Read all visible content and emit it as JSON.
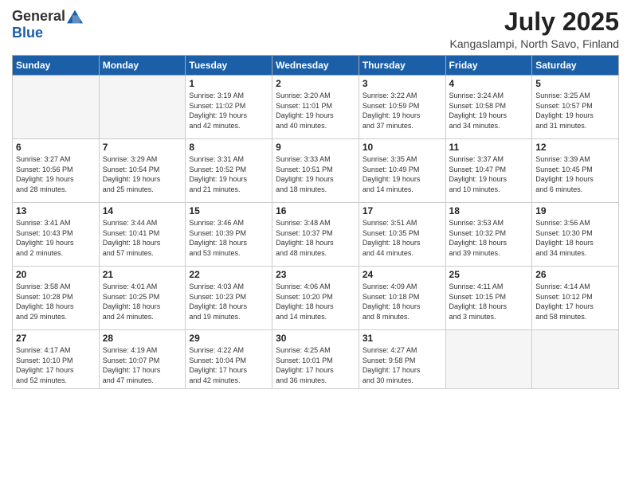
{
  "logo": {
    "general": "General",
    "blue": "Blue"
  },
  "title": "July 2025",
  "location": "Kangaslampi, North Savo, Finland",
  "days_header": [
    "Sunday",
    "Monday",
    "Tuesday",
    "Wednesday",
    "Thursday",
    "Friday",
    "Saturday"
  ],
  "weeks": [
    [
      {
        "day": "",
        "info": ""
      },
      {
        "day": "",
        "info": ""
      },
      {
        "day": "1",
        "info": "Sunrise: 3:19 AM\nSunset: 11:02 PM\nDaylight: 19 hours\nand 42 minutes."
      },
      {
        "day": "2",
        "info": "Sunrise: 3:20 AM\nSunset: 11:01 PM\nDaylight: 19 hours\nand 40 minutes."
      },
      {
        "day": "3",
        "info": "Sunrise: 3:22 AM\nSunset: 10:59 PM\nDaylight: 19 hours\nand 37 minutes."
      },
      {
        "day": "4",
        "info": "Sunrise: 3:24 AM\nSunset: 10:58 PM\nDaylight: 19 hours\nand 34 minutes."
      },
      {
        "day": "5",
        "info": "Sunrise: 3:25 AM\nSunset: 10:57 PM\nDaylight: 19 hours\nand 31 minutes."
      }
    ],
    [
      {
        "day": "6",
        "info": "Sunrise: 3:27 AM\nSunset: 10:56 PM\nDaylight: 19 hours\nand 28 minutes."
      },
      {
        "day": "7",
        "info": "Sunrise: 3:29 AM\nSunset: 10:54 PM\nDaylight: 19 hours\nand 25 minutes."
      },
      {
        "day": "8",
        "info": "Sunrise: 3:31 AM\nSunset: 10:52 PM\nDaylight: 19 hours\nand 21 minutes."
      },
      {
        "day": "9",
        "info": "Sunrise: 3:33 AM\nSunset: 10:51 PM\nDaylight: 19 hours\nand 18 minutes."
      },
      {
        "day": "10",
        "info": "Sunrise: 3:35 AM\nSunset: 10:49 PM\nDaylight: 19 hours\nand 14 minutes."
      },
      {
        "day": "11",
        "info": "Sunrise: 3:37 AM\nSunset: 10:47 PM\nDaylight: 19 hours\nand 10 minutes."
      },
      {
        "day": "12",
        "info": "Sunrise: 3:39 AM\nSunset: 10:45 PM\nDaylight: 19 hours\nand 6 minutes."
      }
    ],
    [
      {
        "day": "13",
        "info": "Sunrise: 3:41 AM\nSunset: 10:43 PM\nDaylight: 19 hours\nand 2 minutes."
      },
      {
        "day": "14",
        "info": "Sunrise: 3:44 AM\nSunset: 10:41 PM\nDaylight: 18 hours\nand 57 minutes."
      },
      {
        "day": "15",
        "info": "Sunrise: 3:46 AM\nSunset: 10:39 PM\nDaylight: 18 hours\nand 53 minutes."
      },
      {
        "day": "16",
        "info": "Sunrise: 3:48 AM\nSunset: 10:37 PM\nDaylight: 18 hours\nand 48 minutes."
      },
      {
        "day": "17",
        "info": "Sunrise: 3:51 AM\nSunset: 10:35 PM\nDaylight: 18 hours\nand 44 minutes."
      },
      {
        "day": "18",
        "info": "Sunrise: 3:53 AM\nSunset: 10:32 PM\nDaylight: 18 hours\nand 39 minutes."
      },
      {
        "day": "19",
        "info": "Sunrise: 3:56 AM\nSunset: 10:30 PM\nDaylight: 18 hours\nand 34 minutes."
      }
    ],
    [
      {
        "day": "20",
        "info": "Sunrise: 3:58 AM\nSunset: 10:28 PM\nDaylight: 18 hours\nand 29 minutes."
      },
      {
        "day": "21",
        "info": "Sunrise: 4:01 AM\nSunset: 10:25 PM\nDaylight: 18 hours\nand 24 minutes."
      },
      {
        "day": "22",
        "info": "Sunrise: 4:03 AM\nSunset: 10:23 PM\nDaylight: 18 hours\nand 19 minutes."
      },
      {
        "day": "23",
        "info": "Sunrise: 4:06 AM\nSunset: 10:20 PM\nDaylight: 18 hours\nand 14 minutes."
      },
      {
        "day": "24",
        "info": "Sunrise: 4:09 AM\nSunset: 10:18 PM\nDaylight: 18 hours\nand 8 minutes."
      },
      {
        "day": "25",
        "info": "Sunrise: 4:11 AM\nSunset: 10:15 PM\nDaylight: 18 hours\nand 3 minutes."
      },
      {
        "day": "26",
        "info": "Sunrise: 4:14 AM\nSunset: 10:12 PM\nDaylight: 17 hours\nand 58 minutes."
      }
    ],
    [
      {
        "day": "27",
        "info": "Sunrise: 4:17 AM\nSunset: 10:10 PM\nDaylight: 17 hours\nand 52 minutes."
      },
      {
        "day": "28",
        "info": "Sunrise: 4:19 AM\nSunset: 10:07 PM\nDaylight: 17 hours\nand 47 minutes."
      },
      {
        "day": "29",
        "info": "Sunrise: 4:22 AM\nSunset: 10:04 PM\nDaylight: 17 hours\nand 42 minutes."
      },
      {
        "day": "30",
        "info": "Sunrise: 4:25 AM\nSunset: 10:01 PM\nDaylight: 17 hours\nand 36 minutes."
      },
      {
        "day": "31",
        "info": "Sunrise: 4:27 AM\nSunset: 9:58 PM\nDaylight: 17 hours\nand 30 minutes."
      },
      {
        "day": "",
        "info": ""
      },
      {
        "day": "",
        "info": ""
      }
    ]
  ]
}
